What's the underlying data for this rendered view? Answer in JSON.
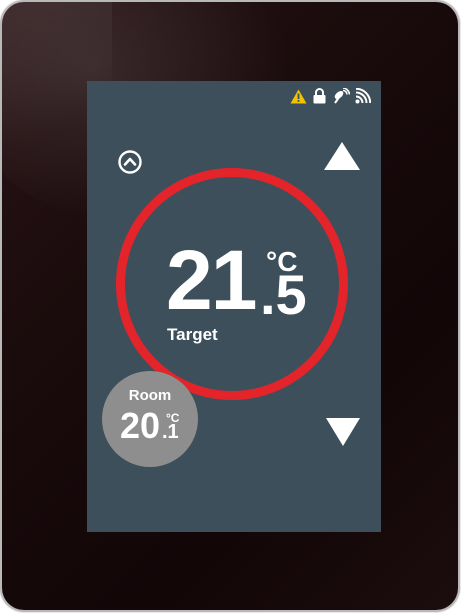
{
  "status_icons": [
    "warning-icon",
    "lock-icon",
    "satellite-icon",
    "wifi-icon"
  ],
  "colors": {
    "screen_bg": "#3d4f5a",
    "ring": "#e3242b",
    "room_bubble": "#8e8e8e",
    "warning": "#f2c200"
  },
  "target": {
    "integer": "21",
    "unit": "°C",
    "decimal": ".5",
    "label": "Target"
  },
  "room": {
    "label": "Room",
    "integer": "20",
    "unit": "°C",
    "decimal": ".1"
  }
}
